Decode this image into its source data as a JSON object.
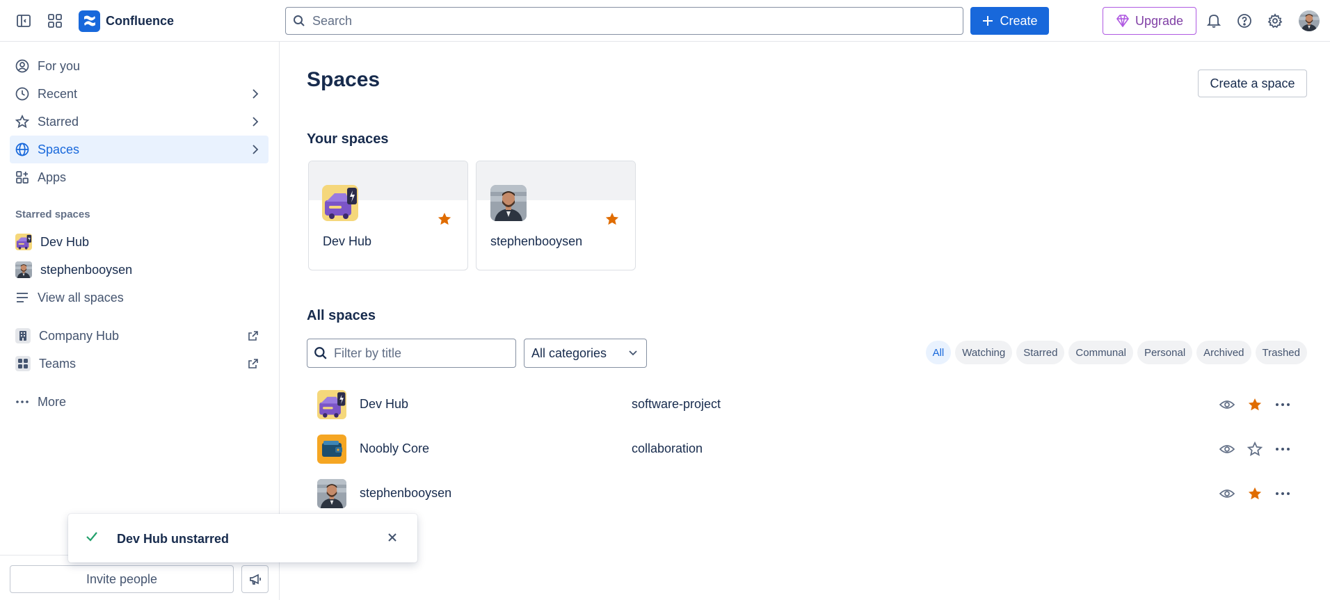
{
  "app": {
    "name": "Confluence"
  },
  "header": {
    "search_placeholder": "Search",
    "create_label": "Create",
    "upgrade_label": "Upgrade"
  },
  "sidebar": {
    "nav": [
      {
        "label": "For you",
        "icon": "user-circle-icon"
      },
      {
        "label": "Recent",
        "icon": "clock-icon"
      },
      {
        "label": "Starred",
        "icon": "star-icon"
      },
      {
        "label": "Spaces",
        "icon": "globe-icon",
        "active": true
      },
      {
        "label": "Apps",
        "icon": "apps-icon"
      }
    ],
    "starred_spaces_label": "Starred spaces",
    "starred_spaces": [
      {
        "label": "Dev Hub"
      },
      {
        "label": "stephenbooysen"
      }
    ],
    "view_all_label": "View all spaces",
    "links": [
      {
        "label": "Company Hub",
        "icon": "building-icon"
      },
      {
        "label": "Teams",
        "icon": "teams-icon"
      }
    ],
    "more_label": "More",
    "invite_label": "Invite people"
  },
  "main": {
    "title": "Spaces",
    "create_space_label": "Create a space",
    "your_spaces_label": "Your spaces",
    "your_spaces": [
      {
        "name": "Dev Hub",
        "starred": true
      },
      {
        "name": "stephenbooysen",
        "starred": true
      }
    ],
    "all_spaces_label": "All spaces",
    "filter_placeholder": "Filter by title",
    "category_selected": "All categories",
    "pills": [
      "All",
      "Watching",
      "Starred",
      "Communal",
      "Personal",
      "Archived",
      "Trashed"
    ],
    "rows": [
      {
        "name": "Dev Hub",
        "category": "software-project",
        "starred": true
      },
      {
        "name": "Noobly Core",
        "category": "collaboration",
        "starred": false
      },
      {
        "name": "stephenbooysen",
        "category": "",
        "starred": true
      }
    ]
  },
  "toast": {
    "message": "Dev Hub unstarred"
  },
  "colors": {
    "accent": "#1868db",
    "star": "#e06c00",
    "success": "#22a06b",
    "upgrade": "#803fa5"
  }
}
